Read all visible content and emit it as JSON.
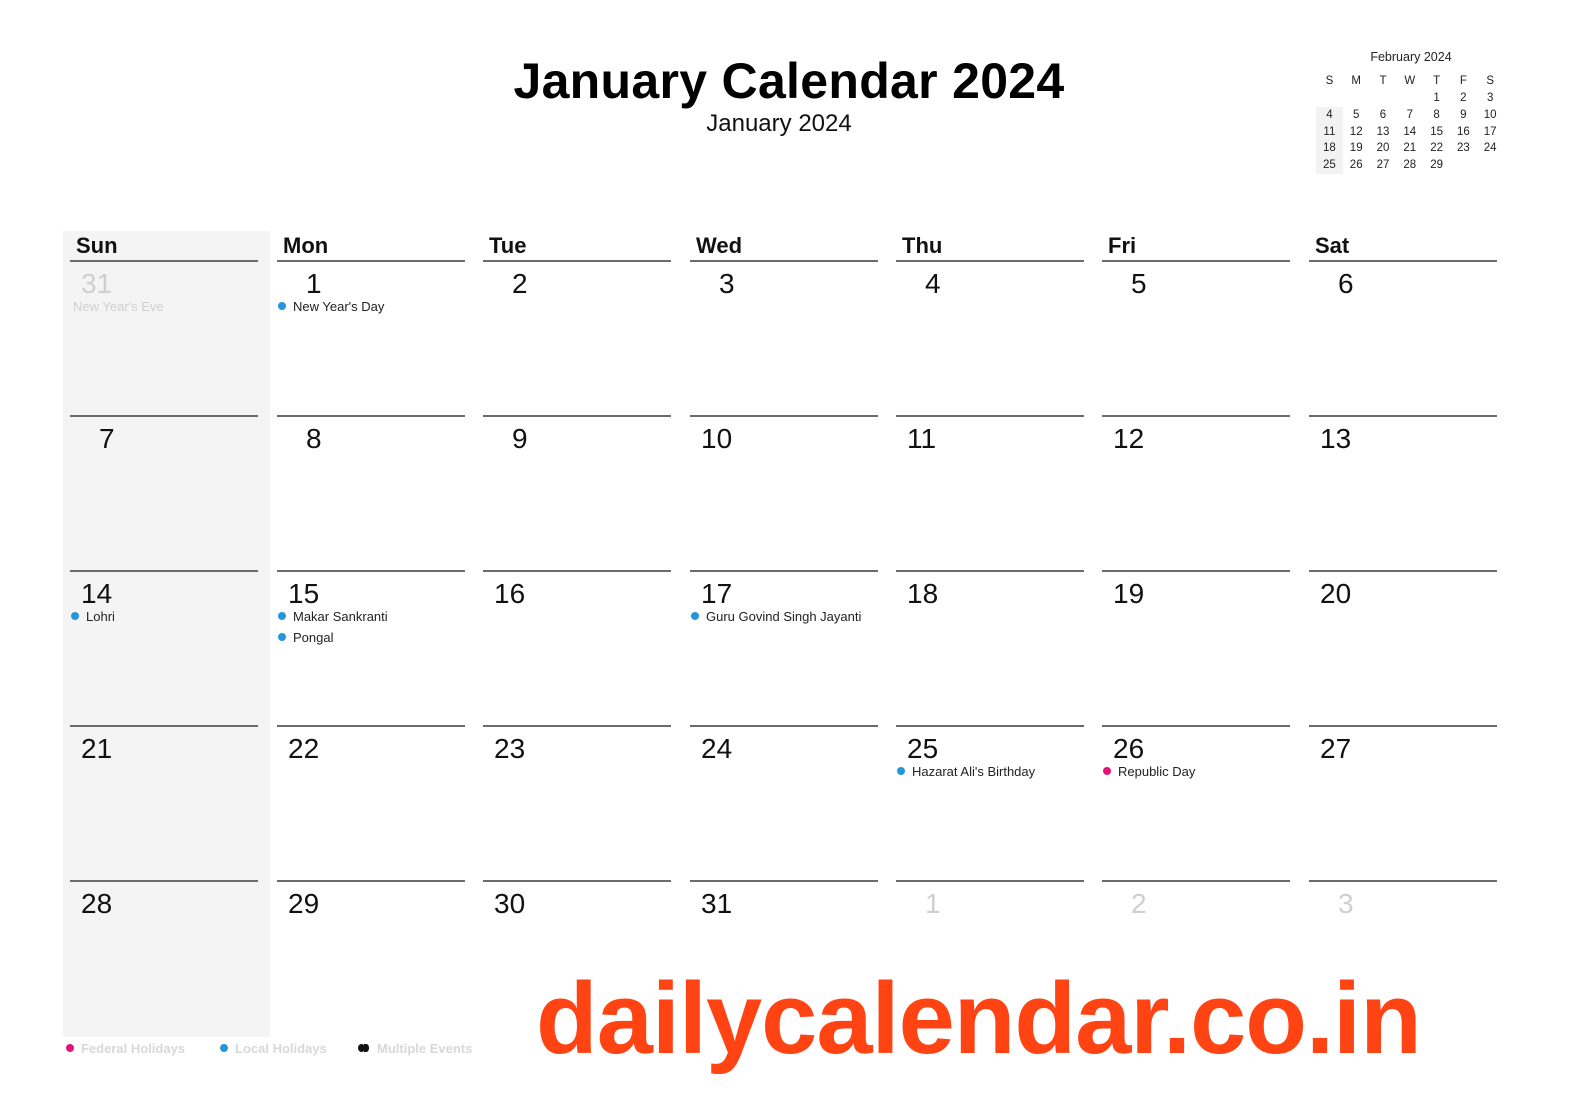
{
  "header": {
    "title": "January Calendar 2024",
    "subtitle": "January 2024"
  },
  "mini_calendar": {
    "title": "February 2024",
    "weekday_headers": [
      "S",
      "M",
      "T",
      "W",
      "T",
      "F",
      "S"
    ],
    "leading_blanks": 4,
    "days": [
      "1",
      "2",
      "3",
      "4",
      "5",
      "6",
      "7",
      "8",
      "9",
      "10",
      "11",
      "12",
      "13",
      "14",
      "15",
      "16",
      "17",
      "18",
      "19",
      "20",
      "21",
      "22",
      "23",
      "24",
      "25",
      "26",
      "27",
      "28",
      "29"
    ]
  },
  "calendar": {
    "weekdays": [
      "Sun",
      "Mon",
      "Tue",
      "Wed",
      "Thu",
      "Fri",
      "Sat"
    ],
    "weeks": [
      [
        {
          "day": "31",
          "faded": true,
          "events": [
            {
              "label": "New Year's Eve",
              "type": "none"
            }
          ]
        },
        {
          "day": "1",
          "events": [
            {
              "label": "New Year's Day",
              "type": "local"
            }
          ]
        },
        {
          "day": "2",
          "events": []
        },
        {
          "day": "3",
          "events": []
        },
        {
          "day": "4",
          "events": []
        },
        {
          "day": "5",
          "events": []
        },
        {
          "day": "6",
          "events": []
        }
      ],
      [
        {
          "day": "7",
          "events": []
        },
        {
          "day": "8",
          "events": []
        },
        {
          "day": "9",
          "events": []
        },
        {
          "day": "10",
          "events": []
        },
        {
          "day": "11",
          "events": []
        },
        {
          "day": "12",
          "events": []
        },
        {
          "day": "13",
          "events": []
        }
      ],
      [
        {
          "day": "14",
          "events": [
            {
              "label": "Lohri",
              "type": "local"
            }
          ]
        },
        {
          "day": "15",
          "events": [
            {
              "label": "Makar Sankranti",
              "type": "local"
            },
            {
              "label": "Pongal",
              "type": "local"
            }
          ]
        },
        {
          "day": "16",
          "events": []
        },
        {
          "day": "17",
          "events": [
            {
              "label": "Guru Govind Singh Jayanti",
              "type": "local"
            }
          ]
        },
        {
          "day": "18",
          "events": []
        },
        {
          "day": "19",
          "events": []
        },
        {
          "day": "20",
          "events": []
        }
      ],
      [
        {
          "day": "21",
          "events": []
        },
        {
          "day": "22",
          "events": []
        },
        {
          "day": "23",
          "events": []
        },
        {
          "day": "24",
          "events": []
        },
        {
          "day": "25",
          "events": [
            {
              "label": "Hazarat Ali's Birthday",
              "type": "local"
            }
          ]
        },
        {
          "day": "26",
          "events": [
            {
              "label": "Republic Day",
              "type": "federal"
            }
          ]
        },
        {
          "day": "27",
          "events": []
        }
      ],
      [
        {
          "day": "28",
          "events": []
        },
        {
          "day": "29",
          "events": []
        },
        {
          "day": "30",
          "events": []
        },
        {
          "day": "31",
          "events": []
        },
        {
          "day": "1",
          "faded": true,
          "events": []
        },
        {
          "day": "2",
          "faded": true,
          "events": []
        },
        {
          "day": "3",
          "faded": true,
          "events": []
        }
      ]
    ]
  },
  "legend": {
    "federal": "Federal Holidays",
    "local": "Local Holidays",
    "multiple": "Multiple Events"
  },
  "colors": {
    "federal": "#e0157a",
    "local": "#2496dc",
    "watermark": "#ff4313"
  },
  "watermark": "dailycalendar.co.in"
}
